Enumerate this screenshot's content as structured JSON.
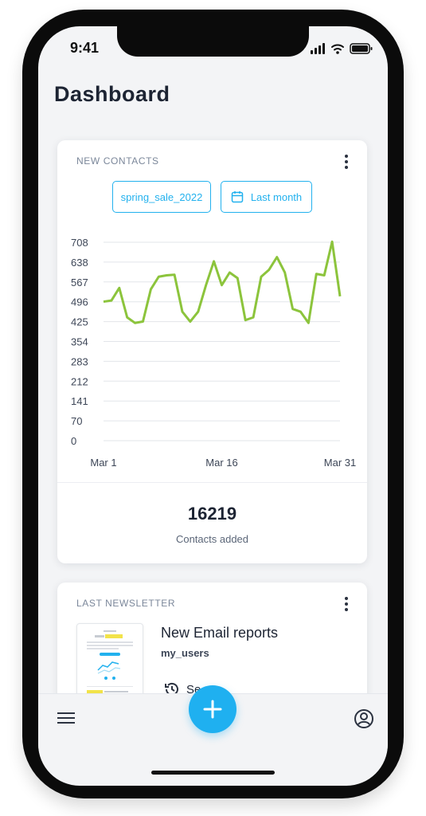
{
  "status_bar": {
    "time": "9:41"
  },
  "page": {
    "title": "Dashboard"
  },
  "contacts_card": {
    "label": "NEW CONTACTS",
    "filter_segment": "spring_sale_2022",
    "filter_period": "Last month",
    "total": "16219",
    "total_label": "Contacts added"
  },
  "chart_data": {
    "type": "line",
    "title": "",
    "xlabel": "",
    "ylabel": "",
    "x_tick_labels": [
      "Mar 1",
      "Mar 16",
      "Mar 31"
    ],
    "y_tick_labels": [
      "708",
      "638",
      "567",
      "496",
      "425",
      "354",
      "283",
      "212",
      "141",
      "70",
      "0"
    ],
    "ylim": [
      0,
      708
    ],
    "grid": true,
    "color": "#8cc43c",
    "x": [
      1,
      2,
      3,
      4,
      5,
      6,
      7,
      8,
      9,
      10,
      11,
      12,
      13,
      14,
      15,
      16,
      17,
      18,
      19,
      20,
      21,
      22,
      23,
      24,
      25,
      26,
      27,
      28,
      29,
      30,
      31
    ],
    "series": [
      {
        "values": [
          496,
          500,
          545,
          440,
          420,
          425,
          540,
          585,
          590,
          592,
          460,
          425,
          460,
          555,
          640,
          555,
          600,
          580,
          430,
          440,
          585,
          610,
          655,
          600,
          470,
          460,
          420,
          595,
          590,
          710,
          515
        ]
      }
    ]
  },
  "newsletter_card": {
    "label": "LAST NEWSLETTER",
    "title": "New Email reports",
    "list": "my_users",
    "schedule_text": "Se"
  },
  "colors": {
    "accent": "#1fb0f0",
    "line": "#8cc43c",
    "text": "#1d2433"
  },
  "icons": [
    "calendar-icon",
    "kebab-menu-icon",
    "hamburger-menu-icon",
    "plus-icon",
    "account-icon",
    "clock-icon",
    "signal-icon",
    "wifi-icon",
    "battery-icon"
  ]
}
